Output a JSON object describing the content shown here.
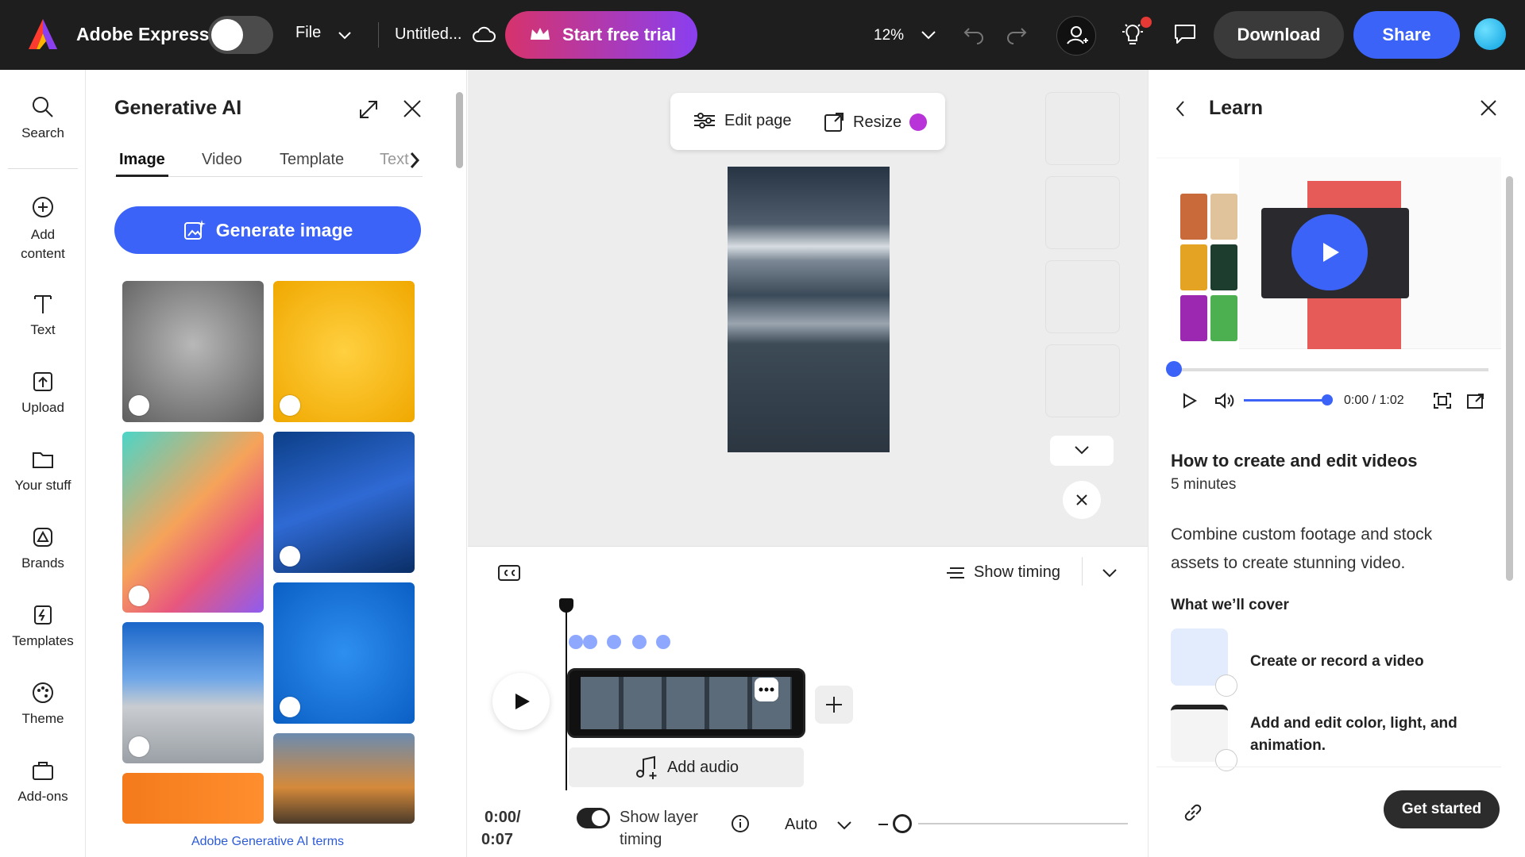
{
  "topbar": {
    "app_name": "Adobe Express",
    "file_label": "File",
    "doc_title": "Untitled...",
    "trial_label": "Start free trial",
    "zoom": "12%",
    "download_label": "Download",
    "share_label": "Share"
  },
  "rail": {
    "items": [
      {
        "label": "Search",
        "icon": "search-icon"
      },
      {
        "label": "Add content",
        "icon": "plus-circle-icon"
      },
      {
        "label": "Text",
        "icon": "text-icon"
      },
      {
        "label": "Upload",
        "icon": "upload-icon"
      },
      {
        "label": "Your stuff",
        "icon": "folder-icon"
      },
      {
        "label": "Brands",
        "icon": "brand-icon"
      },
      {
        "label": "Templates",
        "icon": "templates-icon"
      },
      {
        "label": "Theme",
        "icon": "palette-icon"
      },
      {
        "label": "Add-ons",
        "icon": "addons-icon"
      }
    ]
  },
  "gen_panel": {
    "title": "Generative AI",
    "tabs": [
      "Image",
      "Video",
      "Template",
      "Text"
    ],
    "generate_label": "Generate image",
    "terms_label": "Adobe Generative AI terms"
  },
  "canvas": {
    "edit_page_label": "Edit page",
    "resize_label": "Resize"
  },
  "timeline": {
    "show_timing_label": "Show timing",
    "add_audio_label": "Add audio",
    "time_current": "0:00/",
    "time_total": "0:07",
    "layer_timing_label_1": "Show layer",
    "layer_timing_label_2": "timing",
    "speed_label": "Auto"
  },
  "learn": {
    "title": "Learn",
    "video_time": "0:00 / 1:02",
    "heading": "How to create and edit videos",
    "duration": "5 minutes",
    "description": "Combine custom footage and stock assets to create stunning video.",
    "cover_label": "What we’ll cover",
    "cover_items": [
      "Create or record a video",
      "Add and edit color, light, and animation."
    ],
    "get_started_label": "Get started"
  },
  "colors": {
    "accent": "#3b63f7",
    "topbar": "#1e1e1e",
    "trial_gradient_start": "#d6336c",
    "trial_gradient_end": "#8a3ff0"
  }
}
